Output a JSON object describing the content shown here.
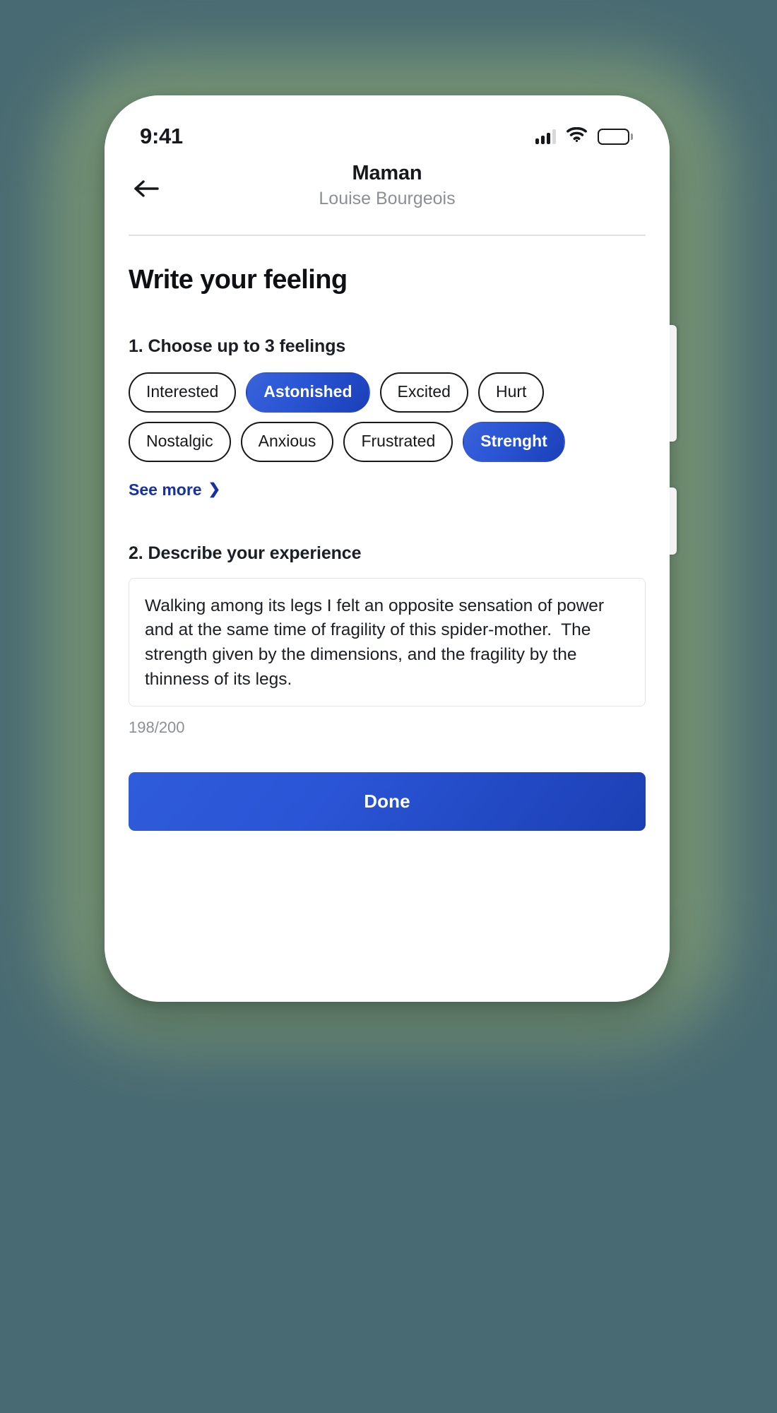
{
  "theme": {
    "backdrop_color": "#486a72",
    "glow_color": "#7e9b78",
    "accent_blue": "#2a55d4",
    "link_blue": "#1630a8",
    "text_dark": "#16181c",
    "text_muted": "#8b9096"
  },
  "status_bar": {
    "time": "9:41",
    "signal_icon": "signal-bars-icon",
    "signal_bars_filled": 3,
    "signal_bars_total": 4,
    "wifi_icon": "wifi-icon",
    "battery_icon": "battery-full-icon"
  },
  "nav": {
    "back_icon": "arrow-left-icon",
    "title": "Maman",
    "subtitle": "Louise Bourgeois"
  },
  "page": {
    "title": "Write your feeling"
  },
  "feelings_section": {
    "heading": "1. Choose up to 3 feelings",
    "chips": [
      {
        "label": "Interested",
        "selected": false
      },
      {
        "label": "Astonished",
        "selected": true
      },
      {
        "label": "Excited",
        "selected": false
      },
      {
        "label": "Hurt",
        "selected": false
      },
      {
        "label": "Nostalgic",
        "selected": false
      },
      {
        "label": "Anxious",
        "selected": false
      },
      {
        "label": "Frustrated",
        "selected": false
      },
      {
        "label": "Strenght",
        "selected": true
      }
    ],
    "see_more_label": "See more",
    "see_more_chevron": "❯"
  },
  "experience_section": {
    "heading": "2. Describe your experience",
    "textarea_value": "Walking among its legs I felt an opposite sensation of power and at the same time of fragility of this spider-mother.  The strength given by the dimensions, and the fragility by the thinness of its legs.",
    "textarea_placeholder": "Describe your experience",
    "char_counter": "198/200",
    "char_count": 198,
    "char_limit": 200
  },
  "actions": {
    "done_label": "Done"
  }
}
